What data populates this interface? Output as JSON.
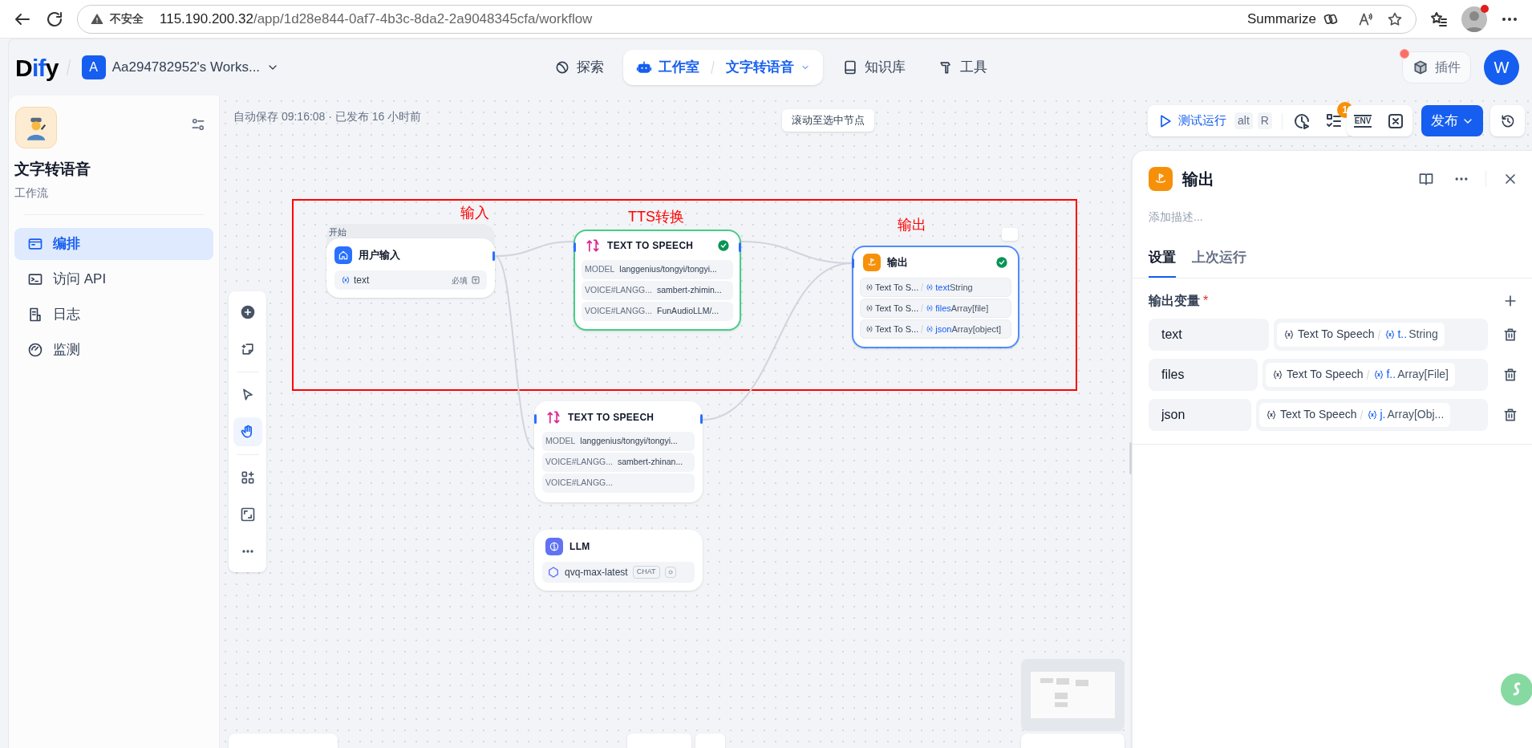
{
  "browser": {
    "security": "不安全",
    "url_host": "115.190.200.32",
    "url_path": "/app/1d28e844-0af7-4b3c-8da2-2a9048345cfa/workflow",
    "summarize": "Summarize"
  },
  "header": {
    "logo": "Dify",
    "workspace": {
      "initial": "A",
      "name": "Aa294782952's Works..."
    },
    "nav": [
      {
        "label": "探索",
        "selected": false
      },
      {
        "label": "工作室",
        "selected": true,
        "breadcrumb": "文字转语音"
      },
      {
        "label": "知识库",
        "selected": false
      },
      {
        "label": "工具",
        "selected": false
      }
    ],
    "plugins": "插件",
    "avatar": "W"
  },
  "sidebar": {
    "app_name": "文字转语音",
    "app_type": "工作流",
    "items": [
      {
        "label": "编排",
        "selected": true
      },
      {
        "label": "访问 API",
        "selected": false
      },
      {
        "label": "日志",
        "selected": false
      },
      {
        "label": "监测",
        "selected": false
      }
    ]
  },
  "canvas": {
    "autosave": "自动保存 09:16:08 · 已发布 16 小时前",
    "scroll_button": "滚动至选中节点",
    "annotations": [
      {
        "text": "输入"
      },
      {
        "text": "TTS转换"
      },
      {
        "text": "输出"
      }
    ],
    "nodes": [
      {
        "kind": "start",
        "group_label": "开始",
        "title": "用户输入",
        "selected": false,
        "succeeded": false,
        "vars": [
          {
            "name": "text",
            "required": "必填"
          }
        ]
      },
      {
        "kind": "tts",
        "title": "TEXT TO SPEECH",
        "selected": false,
        "succeeded": true,
        "rows": [
          {
            "label": "MODEL",
            "value": "langgenius/tongyi/tongyi..."
          },
          {
            "label": "VOICE#LANGG...",
            "value": "sambert-zhimin..."
          },
          {
            "label": "VOICE#LANGG...",
            "value": "FunAudioLLM/..."
          }
        ]
      },
      {
        "kind": "output",
        "title": "输出",
        "selected": true,
        "succeeded": true,
        "rows": [
          {
            "source": "Text To S...",
            "var": "text",
            "type": "String"
          },
          {
            "source": "Text To S...",
            "var": "files",
            "type": "Array[file]"
          },
          {
            "source": "Text To S...",
            "var": "json",
            "type": "Array[object]"
          }
        ]
      },
      {
        "kind": "tts",
        "title": "TEXT TO SPEECH",
        "selected": false,
        "succeeded": false,
        "rows": [
          {
            "label": "MODEL",
            "value": "langgenius/tongyi/tongyi..."
          },
          {
            "label": "VOICE#LANGG...",
            "value": "sambert-zhinan..."
          },
          {
            "label": "VOICE#LANGG..."
          }
        ]
      },
      {
        "kind": "llm",
        "title": "LLM",
        "selected": false,
        "succeeded": false,
        "model": "qvq-max-latest",
        "mode": "CHAT"
      }
    ]
  },
  "toolbar": {
    "run": "测试运行",
    "keys": [
      "alt",
      "R"
    ],
    "badge": "1",
    "env": "ENV",
    "publish": "发布"
  },
  "panel": {
    "title": "输出",
    "description_placeholder": "添加描述...",
    "tabs": [
      {
        "label": "设置",
        "selected": true
      },
      {
        "label": "上次运行",
        "selected": false
      }
    ],
    "section": "输出变量",
    "required_mark": "*",
    "outputs": [
      {
        "name": "text",
        "source": "Text To Speech",
        "var": "t..",
        "type": "String"
      },
      {
        "name": "files",
        "source": "Text To Speech",
        "var": "f..",
        "type": "Array[File]"
      },
      {
        "name": "json",
        "source": "Text To Speech",
        "var": "j.",
        "type": "Array[Obj..."
      }
    ]
  }
}
